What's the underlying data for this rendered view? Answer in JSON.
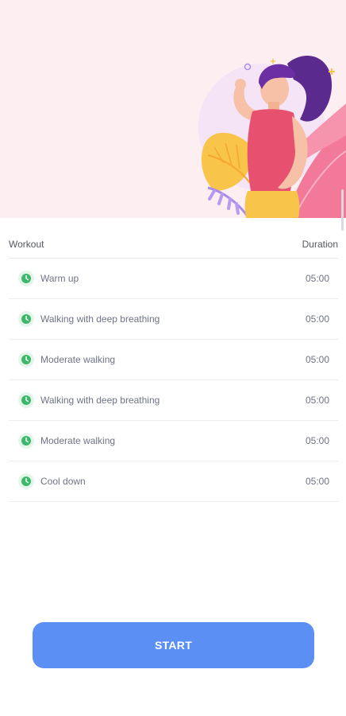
{
  "hero": {
    "illustration_icon": "woman-flexing-illustration",
    "background_color": "#fdeef2"
  },
  "table": {
    "header_workout": "Workout",
    "header_duration": "Duration",
    "rows": [
      {
        "name": "Warm up",
        "duration": "05:00",
        "icon": "clock-icon"
      },
      {
        "name": "Walking with deep breathing",
        "duration": "05:00",
        "icon": "clock-icon"
      },
      {
        "name": "Moderate walking",
        "duration": "05:00",
        "icon": "clock-icon"
      },
      {
        "name": "Walking with deep breathing",
        "duration": "05:00",
        "icon": "clock-icon"
      },
      {
        "name": "Moderate walking",
        "duration": "05:00",
        "icon": "clock-icon"
      },
      {
        "name": "Cool down",
        "duration": "05:00",
        "icon": "clock-icon"
      }
    ]
  },
  "start_button": {
    "label": "START",
    "color": "#5b8ff4"
  },
  "colors": {
    "accent": "#5b8ff4",
    "clock_green": "#3cb86a",
    "text_muted": "#6f7385"
  }
}
